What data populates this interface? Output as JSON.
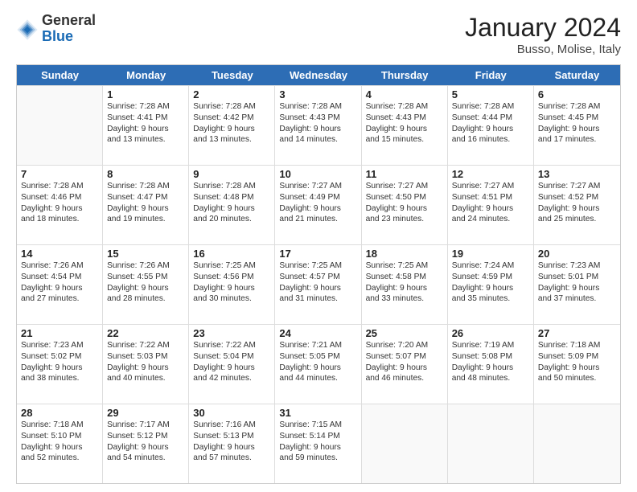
{
  "title": "January 2024",
  "subtitle": "Busso, Molise, Italy",
  "logo": {
    "general": "General",
    "blue": "Blue"
  },
  "days_of_week": [
    "Sunday",
    "Monday",
    "Tuesday",
    "Wednesday",
    "Thursday",
    "Friday",
    "Saturday"
  ],
  "weeks": [
    [
      {
        "day": "",
        "empty": true
      },
      {
        "day": "1",
        "sunrise": "Sunrise: 7:28 AM",
        "sunset": "Sunset: 4:41 PM",
        "daylight": "Daylight: 9 hours and 13 minutes."
      },
      {
        "day": "2",
        "sunrise": "Sunrise: 7:28 AM",
        "sunset": "Sunset: 4:42 PM",
        "daylight": "Daylight: 9 hours and 13 minutes."
      },
      {
        "day": "3",
        "sunrise": "Sunrise: 7:28 AM",
        "sunset": "Sunset: 4:43 PM",
        "daylight": "Daylight: 9 hours and 14 minutes."
      },
      {
        "day": "4",
        "sunrise": "Sunrise: 7:28 AM",
        "sunset": "Sunset: 4:43 PM",
        "daylight": "Daylight: 9 hours and 15 minutes."
      },
      {
        "day": "5",
        "sunrise": "Sunrise: 7:28 AM",
        "sunset": "Sunset: 4:44 PM",
        "daylight": "Daylight: 9 hours and 16 minutes."
      },
      {
        "day": "6",
        "sunrise": "Sunrise: 7:28 AM",
        "sunset": "Sunset: 4:45 PM",
        "daylight": "Daylight: 9 hours and 17 minutes."
      }
    ],
    [
      {
        "day": "7",
        "sunrise": "Sunrise: 7:28 AM",
        "sunset": "Sunset: 4:46 PM",
        "daylight": "Daylight: 9 hours and 18 minutes."
      },
      {
        "day": "8",
        "sunrise": "Sunrise: 7:28 AM",
        "sunset": "Sunset: 4:47 PM",
        "daylight": "Daylight: 9 hours and 19 minutes."
      },
      {
        "day": "9",
        "sunrise": "Sunrise: 7:28 AM",
        "sunset": "Sunset: 4:48 PM",
        "daylight": "Daylight: 9 hours and 20 minutes."
      },
      {
        "day": "10",
        "sunrise": "Sunrise: 7:27 AM",
        "sunset": "Sunset: 4:49 PM",
        "daylight": "Daylight: 9 hours and 21 minutes."
      },
      {
        "day": "11",
        "sunrise": "Sunrise: 7:27 AM",
        "sunset": "Sunset: 4:50 PM",
        "daylight": "Daylight: 9 hours and 23 minutes."
      },
      {
        "day": "12",
        "sunrise": "Sunrise: 7:27 AM",
        "sunset": "Sunset: 4:51 PM",
        "daylight": "Daylight: 9 hours and 24 minutes."
      },
      {
        "day": "13",
        "sunrise": "Sunrise: 7:27 AM",
        "sunset": "Sunset: 4:52 PM",
        "daylight": "Daylight: 9 hours and 25 minutes."
      }
    ],
    [
      {
        "day": "14",
        "sunrise": "Sunrise: 7:26 AM",
        "sunset": "Sunset: 4:54 PM",
        "daylight": "Daylight: 9 hours and 27 minutes."
      },
      {
        "day": "15",
        "sunrise": "Sunrise: 7:26 AM",
        "sunset": "Sunset: 4:55 PM",
        "daylight": "Daylight: 9 hours and 28 minutes."
      },
      {
        "day": "16",
        "sunrise": "Sunrise: 7:25 AM",
        "sunset": "Sunset: 4:56 PM",
        "daylight": "Daylight: 9 hours and 30 minutes."
      },
      {
        "day": "17",
        "sunrise": "Sunrise: 7:25 AM",
        "sunset": "Sunset: 4:57 PM",
        "daylight": "Daylight: 9 hours and 31 minutes."
      },
      {
        "day": "18",
        "sunrise": "Sunrise: 7:25 AM",
        "sunset": "Sunset: 4:58 PM",
        "daylight": "Daylight: 9 hours and 33 minutes."
      },
      {
        "day": "19",
        "sunrise": "Sunrise: 7:24 AM",
        "sunset": "Sunset: 4:59 PM",
        "daylight": "Daylight: 9 hours and 35 minutes."
      },
      {
        "day": "20",
        "sunrise": "Sunrise: 7:23 AM",
        "sunset": "Sunset: 5:01 PM",
        "daylight": "Daylight: 9 hours and 37 minutes."
      }
    ],
    [
      {
        "day": "21",
        "sunrise": "Sunrise: 7:23 AM",
        "sunset": "Sunset: 5:02 PM",
        "daylight": "Daylight: 9 hours and 38 minutes."
      },
      {
        "day": "22",
        "sunrise": "Sunrise: 7:22 AM",
        "sunset": "Sunset: 5:03 PM",
        "daylight": "Daylight: 9 hours and 40 minutes."
      },
      {
        "day": "23",
        "sunrise": "Sunrise: 7:22 AM",
        "sunset": "Sunset: 5:04 PM",
        "daylight": "Daylight: 9 hours and 42 minutes."
      },
      {
        "day": "24",
        "sunrise": "Sunrise: 7:21 AM",
        "sunset": "Sunset: 5:05 PM",
        "daylight": "Daylight: 9 hours and 44 minutes."
      },
      {
        "day": "25",
        "sunrise": "Sunrise: 7:20 AM",
        "sunset": "Sunset: 5:07 PM",
        "daylight": "Daylight: 9 hours and 46 minutes."
      },
      {
        "day": "26",
        "sunrise": "Sunrise: 7:19 AM",
        "sunset": "Sunset: 5:08 PM",
        "daylight": "Daylight: 9 hours and 48 minutes."
      },
      {
        "day": "27",
        "sunrise": "Sunrise: 7:18 AM",
        "sunset": "Sunset: 5:09 PM",
        "daylight": "Daylight: 9 hours and 50 minutes."
      }
    ],
    [
      {
        "day": "28",
        "sunrise": "Sunrise: 7:18 AM",
        "sunset": "Sunset: 5:10 PM",
        "daylight": "Daylight: 9 hours and 52 minutes."
      },
      {
        "day": "29",
        "sunrise": "Sunrise: 7:17 AM",
        "sunset": "Sunset: 5:12 PM",
        "daylight": "Daylight: 9 hours and 54 minutes."
      },
      {
        "day": "30",
        "sunrise": "Sunrise: 7:16 AM",
        "sunset": "Sunset: 5:13 PM",
        "daylight": "Daylight: 9 hours and 57 minutes."
      },
      {
        "day": "31",
        "sunrise": "Sunrise: 7:15 AM",
        "sunset": "Sunset: 5:14 PM",
        "daylight": "Daylight: 9 hours and 59 minutes."
      },
      {
        "day": "",
        "empty": true
      },
      {
        "day": "",
        "empty": true
      },
      {
        "day": "",
        "empty": true
      }
    ]
  ]
}
